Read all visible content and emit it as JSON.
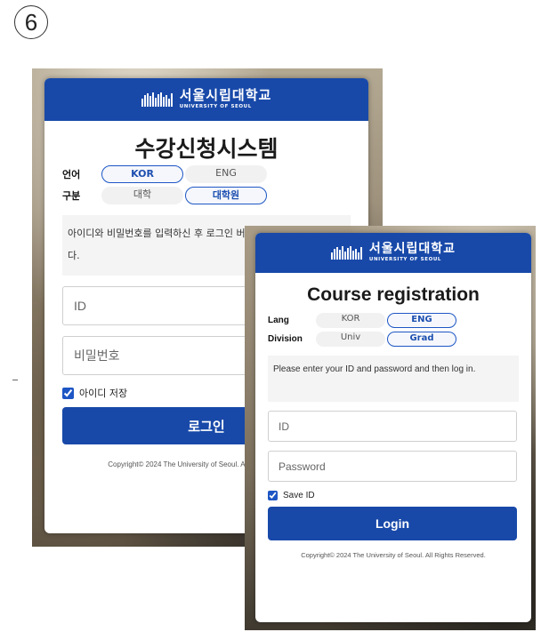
{
  "step_number": "6",
  "colors": {
    "brand": "#1849a9",
    "accent_border": "#1d56c4"
  },
  "korean": {
    "logo": {
      "name": "서울시립대학교",
      "sub": "UNIVERSITY OF SEOUL"
    },
    "title": "수강신청시스템",
    "lang_label": "언어",
    "lang_options": [
      "KOR",
      "ENG"
    ],
    "division_label": "구분",
    "division_options": [
      "대학",
      "대학원"
    ],
    "notice": "아이디와 비밀번호를 입력하신 후 로그인 버튼을 눌러 주시기 바랍니다.",
    "id_placeholder": "ID",
    "password_placeholder": "비밀번호",
    "save_id_label": "아이디 저장",
    "login_label": "로그인",
    "copyright": "Copyright© 2024 The University of Seoul. All Rights Reserved."
  },
  "english": {
    "logo": {
      "name": "서울시립대학교",
      "sub": "UNIVERSITY OF SEOUL"
    },
    "title": "Course registration",
    "lang_label": "Lang",
    "lang_options": [
      "KOR",
      "ENG"
    ],
    "division_label": "Division",
    "division_options": [
      "Univ",
      "Grad"
    ],
    "notice": "Please enter your ID and password and then log in.",
    "id_placeholder": "ID",
    "password_placeholder": "Password",
    "save_id_label": "Save ID",
    "login_label": "Login",
    "copyright": "Copyright© 2024 The University of Seoul. All Rights Reserved."
  }
}
